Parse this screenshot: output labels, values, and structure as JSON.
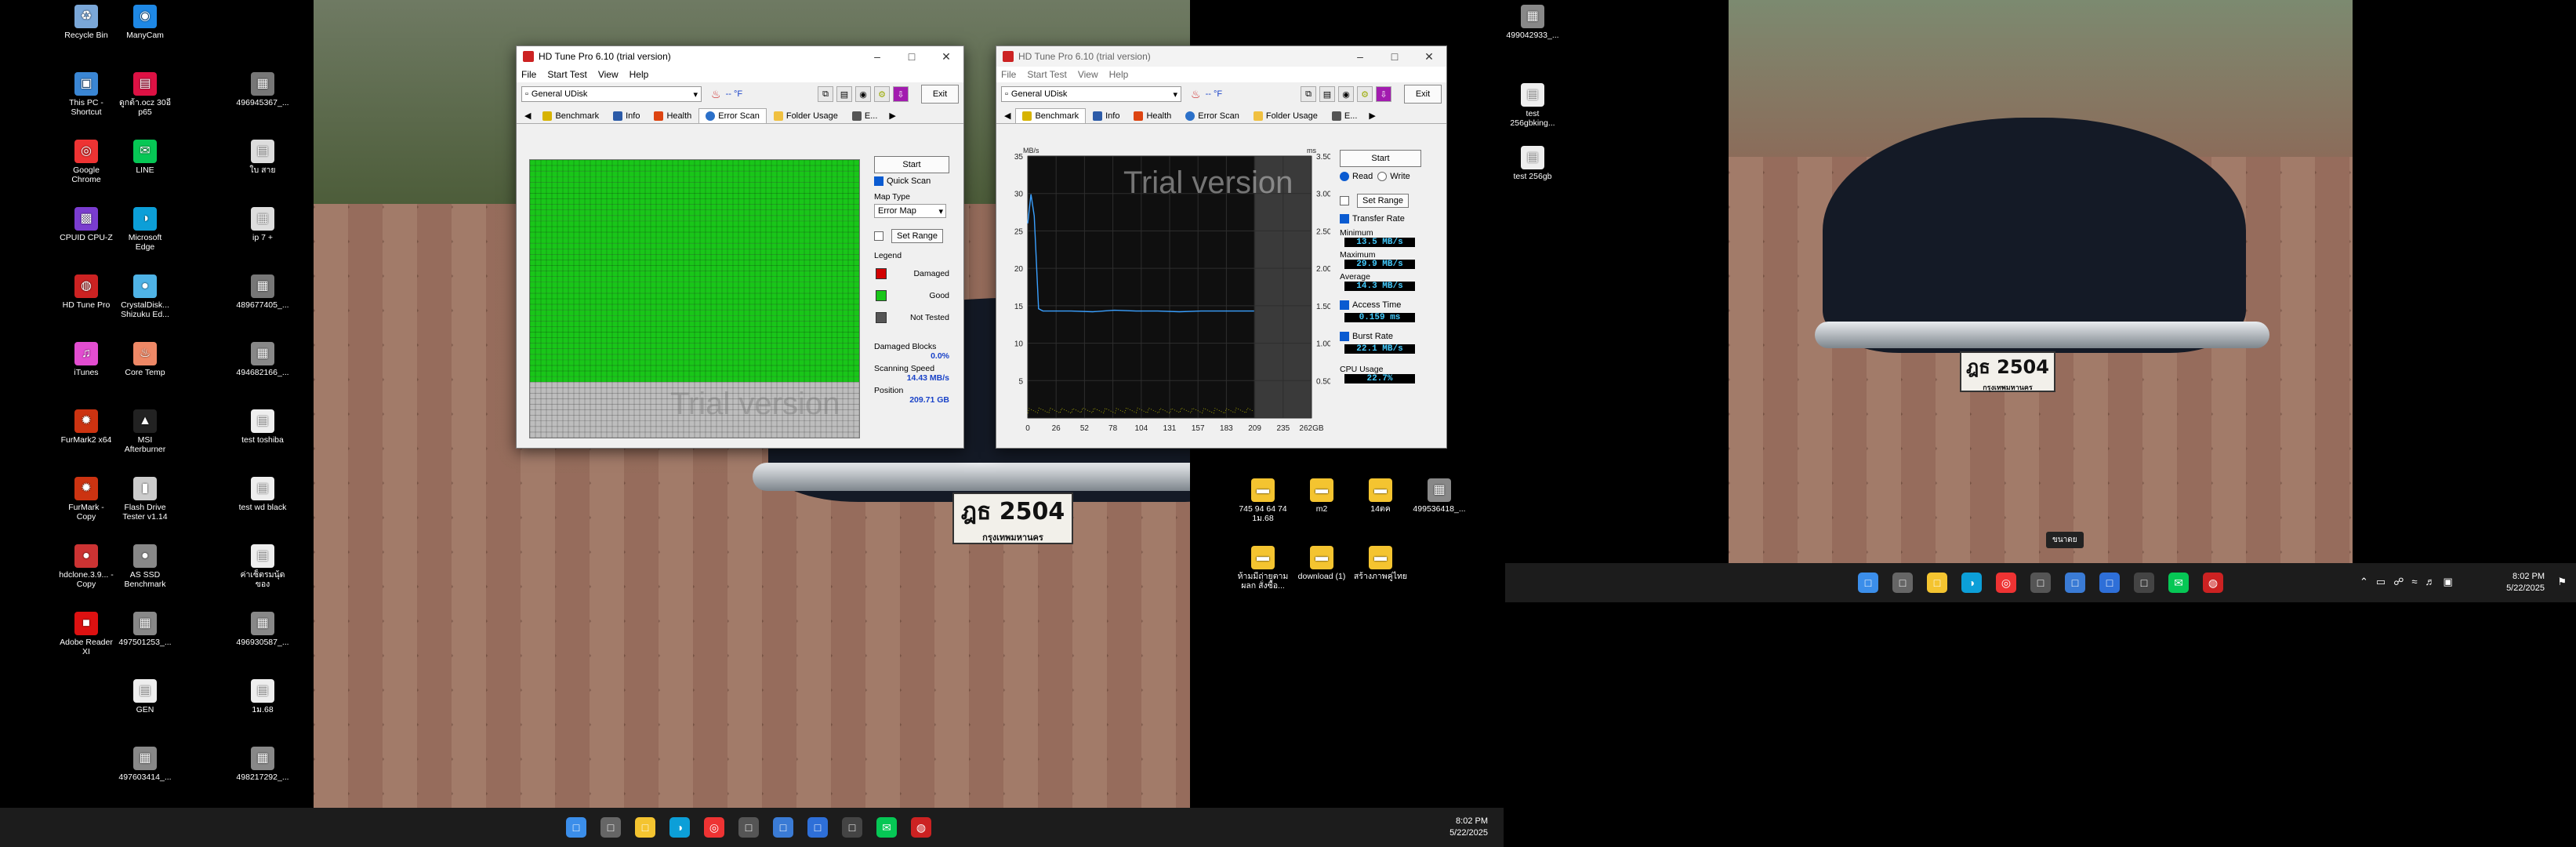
{
  "desktop": {
    "left_icons": [
      {
        "label": "Recycle Bin",
        "icon": "recycle-bin-icon",
        "color": "#7aa7d8"
      },
      {
        "label": "ManyCam",
        "icon": "camera-icon",
        "color": "#1e88e5"
      },
      {
        "label": "This PC - Shortcut",
        "icon": "monitor-icon",
        "color": "#3a86d4"
      },
      {
        "label": "ดูกต้า.ocz 30อี p65",
        "icon": "file-icon",
        "color": "#d14"
      },
      {
        "label": "496945367_...",
        "icon": "image-icon",
        "color": "#777"
      },
      {
        "label": "Google Chrome",
        "icon": "chrome-icon",
        "color": "#e33"
      },
      {
        "label": "LINE",
        "icon": "line-icon",
        "color": "#06c755"
      },
      {
        "label": "ใบ สาย",
        "icon": "file-icon",
        "color": "#ddd"
      },
      {
        "label": "CPUID CPU-Z",
        "icon": "chip-icon",
        "color": "#7a3ccf"
      },
      {
        "label": "Microsoft Edge",
        "icon": "edge-icon",
        "color": "#0c9fd8"
      },
      {
        "label": "ip 7 +",
        "icon": "image-icon",
        "color": "#ddd"
      },
      {
        "label": "HD Tune Pro",
        "icon": "hdtune-icon",
        "color": "#c22"
      },
      {
        "label": "CrystalDisk... Shizuku Ed...",
        "icon": "disk-icon",
        "color": "#4fb3e6"
      },
      {
        "label": "489677405_...",
        "icon": "image-icon",
        "color": "#777"
      },
      {
        "label": "iTunes",
        "icon": "music-icon",
        "color": "#e24dd0"
      },
      {
        "label": "Core Temp",
        "icon": "thermometer-icon",
        "color": "#e86"
      },
      {
        "label": "494682166_...",
        "icon": "image-icon",
        "color": "#888"
      },
      {
        "label": "FurMark2 x64",
        "icon": "furmark-icon",
        "color": "#c31"
      },
      {
        "label": "MSI Afterburner",
        "icon": "msi-icon",
        "color": "#222"
      },
      {
        "label": "test toshiba",
        "icon": "file-icon",
        "color": "#eee"
      },
      {
        "label": "FurMark - Copy",
        "icon": "furmark-icon",
        "color": "#c31"
      },
      {
        "label": "Flash Drive Tester v1.14",
        "icon": "usb-icon",
        "color": "#ccc"
      },
      {
        "label": "test wd black",
        "icon": "file-icon",
        "color": "#eee"
      },
      {
        "label": "hdclone.3.9... - Copy",
        "icon": "disk-icon",
        "color": "#c33"
      },
      {
        "label": "AS SSD Benchmark",
        "icon": "disk-icon",
        "color": "#888"
      },
      {
        "label": "ค่าเซ็ตรมนุ้ด ของ",
        "icon": "file-icon",
        "color": "#eee"
      },
      {
        "label": "Adobe Reader XI",
        "icon": "pdf-icon",
        "color": "#d11"
      },
      {
        "label": "497501253_...",
        "icon": "image-icon",
        "color": "#888"
      },
      {
        "label": "496930587_...",
        "icon": "image-icon",
        "color": "#888"
      },
      {
        "label": "GEN",
        "icon": "file-icon",
        "color": "#eee"
      },
      {
        "label": "1ม.68",
        "icon": "file-icon",
        "color": "#eee"
      },
      {
        "label": "497603414_...",
        "icon": "image-icon",
        "color": "#888"
      },
      {
        "label": "498217292_...",
        "icon": "image-icon",
        "color": "#888"
      }
    ],
    "mid_icons": [
      {
        "label": "745 94 64 74 1ม.68",
        "icon": "folder-icon",
        "color": "#f4c430"
      },
      {
        "label": "m2",
        "icon": "folder-icon",
        "color": "#f4c430"
      },
      {
        "label": "14ตค",
        "icon": "folder-icon",
        "color": "#f4c430"
      },
      {
        "label": "499536418_...",
        "icon": "image-icon",
        "color": "#888"
      },
      {
        "label": "ห้ามมีถ่ายตาม ผลก สั่งซื้อ...",
        "icon": "folder-icon",
        "color": "#f4c430"
      },
      {
        "label": "download (1)",
        "icon": "folder-icon",
        "color": "#f4c430"
      },
      {
        "label": "สร้างภาพคู่ไทย",
        "icon": "folder-icon",
        "color": "#f4c430"
      }
    ],
    "right_icons": [
      {
        "label": "499042933_...",
        "icon": "image-icon",
        "color": "#888"
      },
      {
        "label": "test 256gbking...",
        "icon": "file-icon",
        "color": "#eee"
      },
      {
        "label": "test 256gb",
        "icon": "file-icon",
        "color": "#eee"
      }
    ]
  },
  "plates": {
    "number": "ฎธ 2504",
    "sub": "กรุงเทพมหานคร"
  },
  "wallpaper_tooltip": "ขนาดย",
  "taskbar_left": {
    "time": "8:02 PM",
    "date": "5/22/2025"
  },
  "taskbar_right": {
    "time": "8:02 PM",
    "date": "5/22/2025"
  },
  "taskbar_apps": [
    {
      "icon": "windows-start-icon",
      "color": "#3b8eea"
    },
    {
      "icon": "task-view-icon",
      "color": "#666"
    },
    {
      "icon": "file-explorer-icon",
      "color": "#f4c430"
    },
    {
      "icon": "edge-icon",
      "color": "#0c9fd8"
    },
    {
      "icon": "chrome-icon",
      "color": "#e33"
    },
    {
      "icon": "calculator-icon",
      "color": "#555"
    },
    {
      "icon": "settings-icon",
      "color": "#3a7bd5"
    },
    {
      "icon": "notepad-icon",
      "color": "#2e6fd8"
    },
    {
      "icon": "store-icon",
      "color": "#444"
    },
    {
      "icon": "line-icon",
      "color": "#06c755"
    },
    {
      "icon": "hdtune-icon",
      "color": "#c22"
    }
  ],
  "win1": {
    "title": "HD Tune Pro 6.10 (trial version)",
    "menu": [
      "File",
      "Start Test",
      "View",
      "Help"
    ],
    "drive": "General UDisk",
    "temp": "-- °F",
    "exit": "Exit",
    "tabs": [
      "Benchmark",
      "Info",
      "Health",
      "Error Scan",
      "Folder Usage",
      "E..."
    ],
    "active_tab": "Error Scan",
    "start": "Start",
    "quick_scan": "Quick Scan",
    "map_type_label": "Map Type",
    "map_type_value": "Error Map",
    "set_range": "Set Range",
    "legend_label": "Legend",
    "legend": [
      {
        "label": "Damaged",
        "color": "#d10000"
      },
      {
        "label": "Good",
        "color": "#19c619"
      },
      {
        "label": "Not Tested",
        "color": "#555555"
      }
    ],
    "damaged_blocks_label": "Damaged Blocks",
    "damaged_blocks": "0.0%",
    "scanning_speed_label": "Scanning Speed",
    "scanning_speed": "14.43 MB/s",
    "position_label": "Position",
    "position": "209.71 GB",
    "watermark": "Trial version",
    "scan_progress": 0.8
  },
  "win2": {
    "title": "HD Tune Pro 6.10 (trial version)",
    "menu": [
      "File",
      "Start Test",
      "View",
      "Help"
    ],
    "drive": "General UDisk",
    "temp": "-- °F",
    "exit": "Exit",
    "tabs": [
      "Benchmark",
      "Info",
      "Health",
      "Error Scan",
      "Folder Usage",
      "E..."
    ],
    "active_tab": "Benchmark",
    "start": "Start",
    "read": "Read",
    "write": "Write",
    "set_range": "Set Range",
    "transfer_rate": "Transfer Rate",
    "minimum_label": "Minimum",
    "minimum": "13.5 MB/s",
    "maximum_label": "Maximum",
    "maximum": "29.9 MB/s",
    "average_label": "Average",
    "average": "14.3 MB/s",
    "access_time": "Access Time",
    "access_value": "0.159 ms",
    "burst_rate": "Burst Rate",
    "burst_value": "22.1 MB/s",
    "cpu_usage_label": "CPU Usage",
    "cpu_usage": "22.7%",
    "watermark": "Trial version"
  },
  "chart_data": {
    "type": "line",
    "ylabel": "MB/s",
    "ylabel_right": "ms",
    "xlabel": "",
    "x_ticks": [
      "0",
      "26",
      "52",
      "78",
      "104",
      "131",
      "157",
      "183",
      "209",
      "235",
      "262GB"
    ],
    "y_ticks": [
      "35",
      "30",
      "25",
      "20",
      "15",
      "10",
      "5"
    ],
    "y2_ticks": [
      "3.50",
      "3.00",
      "2.50",
      "2.00",
      "1.50",
      "1.00",
      "0.50"
    ],
    "ylim": [
      0,
      35
    ],
    "xlim": [
      0,
      262
    ],
    "tested_until": 209,
    "series": [
      {
        "x": [
          0,
          3,
          6,
          10,
          14,
          20,
          40,
          60,
          80,
          100,
          120,
          140,
          160,
          180,
          200,
          209
        ],
        "values": [
          26,
          29.9,
          27,
          14.6,
          14.3,
          14.3,
          14.3,
          14.2,
          14.4,
          14.3,
          14.3,
          14.2,
          14.3,
          14.3,
          14.3,
          14.3
        ]
      }
    ]
  }
}
